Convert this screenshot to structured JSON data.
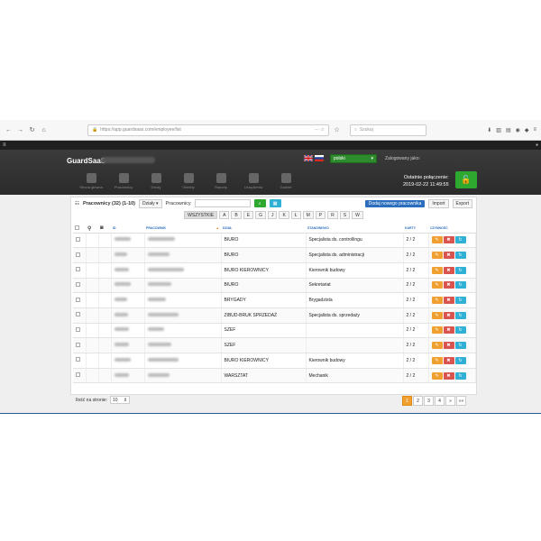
{
  "browser": {
    "url": "https://app.guardsaas.com/employee/list",
    "search_placeholder": "Szukaj"
  },
  "header": {
    "brand": "GuardSaaS",
    "language": "polski",
    "logged_in_label": "Zalogowany jako:",
    "last_login_label": "Ostatnie połączenie:",
    "last_login_value": "2019-02-22 11:49:55",
    "nav": [
      "Strona główna",
      "Pracownicy",
      "Działy",
      "Obiekty",
      "Raporty",
      "Urządzenia",
      "Gadżet"
    ]
  },
  "toolbar": {
    "title": "Pracownicy (32) (1-10)",
    "dept_label": "Działy",
    "search_label": "Pracownicy",
    "add_label": "Dodaj nowego pracownika",
    "import_label": "Import",
    "export_label": "Export"
  },
  "letters": [
    "WSZYSTKIE",
    "A",
    "B",
    "E",
    "G",
    "J",
    "K",
    "Ł",
    "M",
    "P",
    "R",
    "S",
    "W"
  ],
  "table": {
    "headers": [
      "",
      "",
      "",
      "ID",
      "PRACOWNIK",
      "DZIAŁ",
      "STANOWISKO",
      "KARTY",
      "CZYNNOŚĆ"
    ],
    "rows": [
      {
        "dzial": "BIURO",
        "stanowisko": "Specjalista ds. controllingu",
        "karty": "2 / 2"
      },
      {
        "dzial": "BIURO",
        "stanowisko": "Specjalista ds. administracji",
        "karty": "2 / 2"
      },
      {
        "dzial": "BIURO KIEROWNICY",
        "stanowisko": "Kierownik budowy",
        "karty": "2 / 2"
      },
      {
        "dzial": "BIURO",
        "stanowisko": "Sekretariat",
        "karty": "2 / 2"
      },
      {
        "dzial": "BRYGADY",
        "stanowisko": "Brygadzista",
        "karty": "2 / 2"
      },
      {
        "dzial": "ZIBUD-BRUK SPRZEDAŻ",
        "stanowisko": "Specjalista ds. sprzedaży",
        "karty": "2 / 2"
      },
      {
        "dzial": "SZEF",
        "stanowisko": "",
        "karty": "2 / 2"
      },
      {
        "dzial": "SZEF",
        "stanowisko": "",
        "karty": "2 / 2"
      },
      {
        "dzial": "BIURO KIEROWNICY",
        "stanowisko": "Kierownik budowy",
        "karty": "2 / 2"
      },
      {
        "dzial": "WARSZTAT",
        "stanowisko": "Mechanik",
        "karty": "2 / 2"
      }
    ]
  },
  "footer": {
    "per_page_label": "Ilość na stronie:",
    "per_page_value": "10",
    "pages": [
      "1",
      "2",
      "3",
      "4",
      "»",
      "»»"
    ]
  },
  "colors": {
    "edit": "#f0a030",
    "delete": "#d9534f",
    "refresh": "#31b0d5",
    "primary": "#2a6ebd",
    "success": "#2fa82f"
  }
}
